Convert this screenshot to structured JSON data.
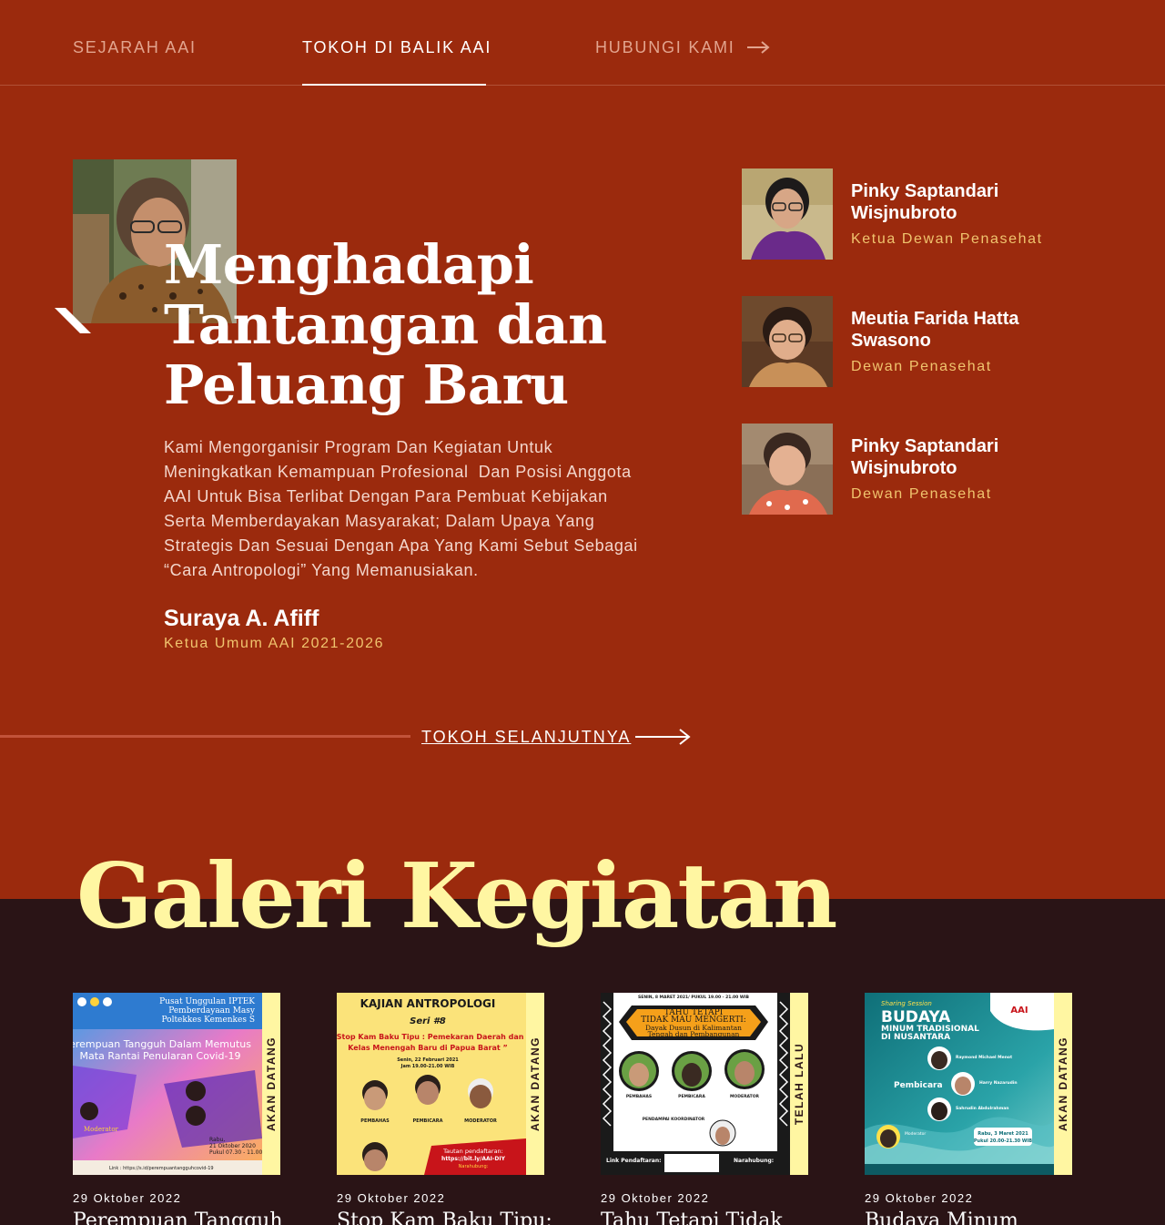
{
  "nav": {
    "items": [
      {
        "label": "SEJARAH AAI",
        "active": false
      },
      {
        "label": "TOKOH DI BALIK AAI",
        "active": true
      },
      {
        "label": "HUBUNGI KAMI",
        "active": false
      }
    ],
    "arrow_icon": "arrow-right-icon"
  },
  "hero": {
    "title_lines": [
      "Menghadapi",
      "Tantangan dan",
      "Peluang Baru"
    ],
    "description_lines": [
      "Kami Mengorganisir Program Dan Kegiatan Untuk",
      "Meningkatkan Kemampuan Profesional  Dan Posisi Anggota",
      "AAI Untuk Bisa Terlibat Dengan Para Pembuat Kebijakan",
      "Serta Memberdayakan Masyarakat; Dalam Upaya Yang",
      "Strategis Dan Sesuai Dengan Apa Yang Kami Sebut Sebagai",
      "“Cara Antropologi” Yang Memanusiakan."
    ],
    "name": "Suraya A. Afiff",
    "role": "Ketua Umum AAI 2021-2026"
  },
  "figures": [
    {
      "name_lines": [
        "Pinky Saptandari",
        "Wisjnubroto"
      ],
      "role": "Ketua Dewan Penasehat"
    },
    {
      "name_lines": [
        "Meutia Farida Hatta",
        "Swasono"
      ],
      "role": "Dewan Penasehat"
    },
    {
      "name_lines": [
        "Pinky Saptandari",
        "Wisjnubroto"
      ],
      "role": "Dewan Penasehat"
    }
  ],
  "next": {
    "label": "TOKOH SELANJUTNYA",
    "arrow_icon": "long-arrow-right-icon"
  },
  "gallery": {
    "title": "Galeri Kegiatan",
    "cards": [
      {
        "status": "AKAN DATANG",
        "date": "29 Oktober 2022",
        "title": "Perempuan Tangguh",
        "poster": {
          "header_lines": [
            "Pusat Unggulan IPTEK",
            "Pemberdayaan Masy",
            "Poltekkes Kemenkes S"
          ],
          "main_lines": [
            "erempuan Tangguh Dalam Memutus",
            "Mata Rantai Penularan Covid-19"
          ],
          "moderator": "Moderator",
          "date_lines": [
            "Rabu,",
            "21 Oktober 2020",
            "Pukul 07.30 - 11.00"
          ],
          "footer": "Link : https://s.id/perempuantangguhcovid-19",
          "colors": {
            "bg": "#4a8fe0",
            "accent": "#ffd23c"
          }
        }
      },
      {
        "status": "AKAN DATANG",
        "date": "29 Oktober 2022",
        "title": "Stop Kam Baku Tipu:",
        "poster": {
          "header": "KAJIAN ANTROPOLOGI",
          "series": "Seri #8",
          "main_lines": [
            "“Stop Kam Baku Tipu : Pemekaran Daerah dan",
            "Kelas Menengah Baru di Papua Barat ”"
          ],
          "date_lines": [
            "Senin, 22 Februari 2021",
            "Jam 19.00-21.00 WIB"
          ],
          "roles": [
            "PEMBAHAS",
            "PEMBICARA",
            "MODERATOR"
          ],
          "link_lines": [
            "Tautan pendaftaran:",
            "https://bit.ly/AAI-DIY",
            "Narahubung:"
          ],
          "colors": {
            "bg": "#fbe37a",
            "accent": "#c8141a"
          }
        }
      },
      {
        "status": "TELAH LALU",
        "date": "29 Oktober 2022",
        "title": "Tahu Tetapi Tidak",
        "poster": {
          "top_bar": "SENIN, 8 MARET 2021/ PUKUL 19.00 - 21.00 WIB",
          "title_lines": [
            "TAHU TETAPI",
            "TIDAK MAU MENGERTI:"
          ],
          "subtitle_lines": [
            "Dayak Dusun di Kalimantan",
            "Tengah dan Pembangunan"
          ],
          "roles": [
            "PEMBAHAS",
            "PEMBICARA",
            "MODERATOR"
          ],
          "coordinator": "PENDAMPAI KOORDINATOR",
          "footer_left": "Link Pendaftaran:",
          "footer_right": "Narahubung:",
          "colors": {
            "bg": "#ffffff",
            "accent": "#f5a01a"
          }
        }
      },
      {
        "status": "AKAN DATANG",
        "date": "29 Oktober 2022",
        "title": "Budaya Minum",
        "poster": {
          "session": "Sharing Session",
          "title": "BUDAYA",
          "subtitle_lines": [
            "MINUM TRADISIONAL",
            "DI NUSANTARA"
          ],
          "badge": "AAI",
          "pembicara": "Pembicara",
          "speakers": [
            "Raymond Michael Menot",
            "Harry Nazarudin",
            "Sahrudin Abdulrahman"
          ],
          "moderator": "Moderator",
          "date_lines": [
            "Rabu, 3 Maret 2021",
            "Pukul 20.00-21.30 WIB"
          ],
          "colors": {
            "bg": "#1b8a93",
            "accent": "#ffe04a"
          }
        }
      }
    ]
  }
}
